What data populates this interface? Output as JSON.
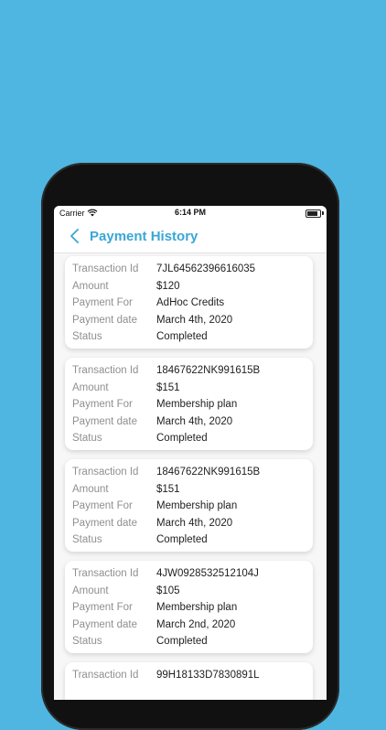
{
  "status_bar": {
    "carrier": "Carrier",
    "time": "6:14 PM"
  },
  "header": {
    "title": "Payment History"
  },
  "labels": {
    "transaction_id": "Transaction Id",
    "amount": "Amount",
    "payment_for": "Payment For",
    "payment_date": "Payment date",
    "status": "Status"
  },
  "transactions": [
    {
      "transaction_id": "7JL64562396616035",
      "amount": "$120",
      "payment_for": "AdHoc Credits",
      "payment_date": "March 4th, 2020",
      "status": "Completed"
    },
    {
      "transaction_id": "18467622NK991615B",
      "amount": "$151",
      "payment_for": "Membership plan",
      "payment_date": "March 4th, 2020",
      "status": "Completed"
    },
    {
      "transaction_id": "18467622NK991615B",
      "amount": "$151",
      "payment_for": "Membership plan",
      "payment_date": "March 4th, 2020",
      "status": "Completed"
    },
    {
      "transaction_id": "4JW0928532512104J",
      "amount": "$105",
      "payment_for": "Membership plan",
      "payment_date": "March 2nd, 2020",
      "status": "Completed"
    },
    {
      "transaction_id": "99H18133D7830891L"
    }
  ],
  "colors": {
    "background": "#4fb6e1",
    "accent": "#3aa6d6"
  },
  "icons": {
    "back": "chevron-left-icon",
    "wifi": "wifi-icon",
    "battery": "battery-icon"
  }
}
